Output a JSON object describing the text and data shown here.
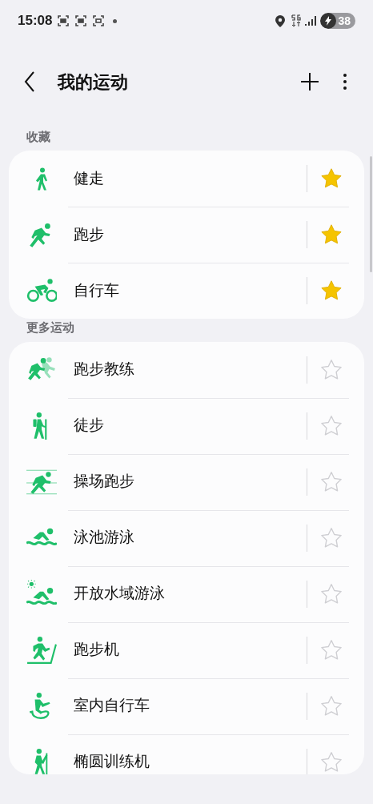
{
  "status_bar": {
    "time": "15:08",
    "battery": "38"
  },
  "header": {
    "title": "我的运动"
  },
  "sections": [
    {
      "title": "收藏",
      "items": [
        {
          "label": "健走",
          "starred": true
        },
        {
          "label": "跑步",
          "starred": true
        },
        {
          "label": "自行车",
          "starred": true
        }
      ]
    },
    {
      "title": "更多运动",
      "items": [
        {
          "label": "跑步教练",
          "starred": false
        },
        {
          "label": "徒步",
          "starred": false
        },
        {
          "label": "操场跑步",
          "starred": false
        },
        {
          "label": "泳池游泳",
          "starred": false
        },
        {
          "label": "开放水域游泳",
          "starred": false
        },
        {
          "label": "跑步机",
          "starred": false
        },
        {
          "label": "室内自行车",
          "starred": false
        },
        {
          "label": "椭圆训练机",
          "starred": false
        }
      ]
    }
  ]
}
